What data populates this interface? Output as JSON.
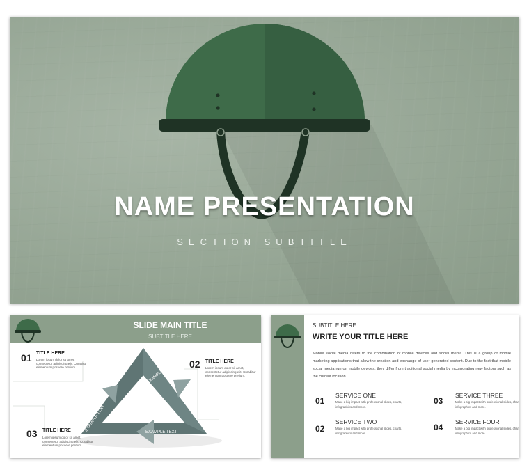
{
  "main_slide": {
    "title": "NAME PRESENTATION",
    "subtitle": "SECTION SUBTITLE",
    "icon": "helmet-icon",
    "colors": {
      "background": "#97a796",
      "helmet": "#3e6b49",
      "strap": "#1f3325"
    }
  },
  "slide_left": {
    "title": "SLIDE MAIN TITLE",
    "subtitle": "SUBTITLE HERE",
    "icon": "helmet-icon",
    "items": [
      {
        "number": "01",
        "title": "TITLE HERE",
        "body": "Lorem ipsum dolor sit amet, consectetur adipiscing elit. Curabitur elementum posuere pretium."
      },
      {
        "number": "02",
        "title": "TITLE HERE",
        "body": "Lorem ipsum dolor sit amet, consectetur adipiscing elit. Curabitur elementum posuere pretium."
      },
      {
        "number": "03",
        "title": "TITLE HERE",
        "body": "Lorem ipsum dolor sit amet, consectetur adipiscing elit. Curabitur elementum posuere pretium."
      }
    ],
    "cycle_labels": [
      "EXAMPLE TEXT",
      "EXAMPLE TEXT",
      "EXAMPLE TEXT"
    ]
  },
  "slide_right": {
    "subtitle": "SUBTITLE HERE",
    "title": "WRITE YOUR TITLE HERE",
    "paragraph": "Mobile social media refers to the combination of mobile devices and social media. This is a group of mobile marketing applications that allow the creation and exchange of user-generated content. Due to the fact that mobile social media run on mobile devices, they differ from traditional social media by incorporating new factors such as the current location.",
    "services": [
      {
        "number": "01",
        "title": "SERVICE ONE",
        "body": "Make a big impact with professional slides, charts, infographics and more."
      },
      {
        "number": "02",
        "title": "SERVICE TWO",
        "body": "Make a big impact with professional slides, charts, infographics and more."
      },
      {
        "number": "03",
        "title": "SERVICE THREE",
        "body": "Make a big impact with professional slides, charts, infographics and more."
      },
      {
        "number": "04",
        "title": "SERVICE FOUR",
        "body": "Make a big impact with professional slides, charts, infographics and more."
      }
    ]
  }
}
